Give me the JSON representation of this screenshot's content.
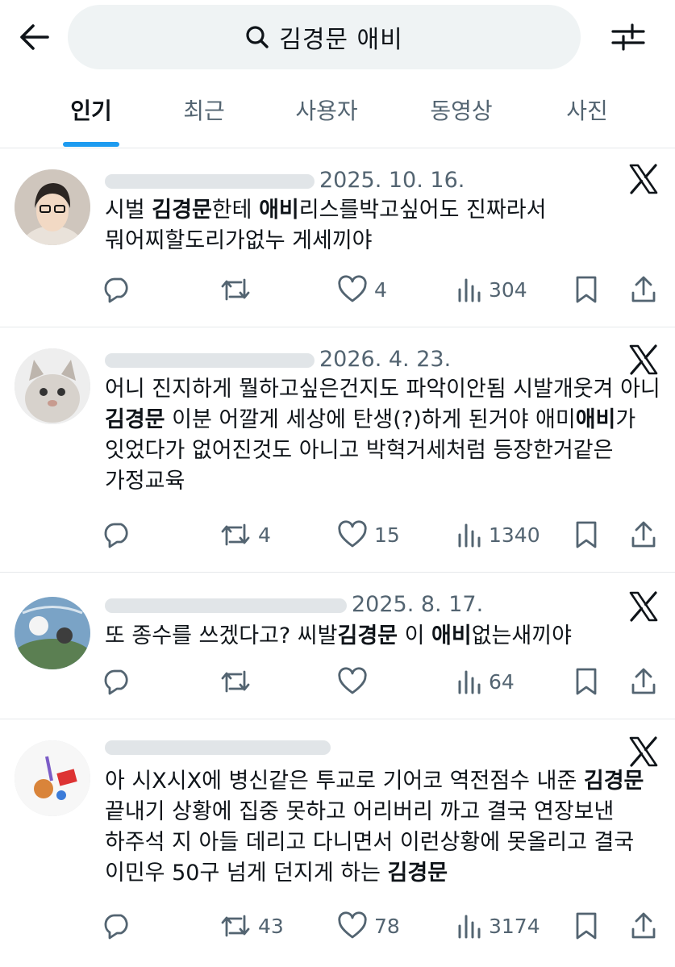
{
  "search": {
    "query": "김경문 애비"
  },
  "tabs": [
    {
      "label": "인기"
    },
    {
      "label": "최근"
    },
    {
      "label": "사용자"
    },
    {
      "label": "동영상"
    },
    {
      "label": "사진"
    }
  ],
  "active_tab": "인기",
  "posts": [
    {
      "date": "2025. 10. 16.",
      "text_parts": [
        "시벌 ",
        "김경문",
        "한테 ",
        "애비",
        "리스를박고싶어도 진짜라서 뭐어찌할도리가없누  게세끼야"
      ],
      "replies": "",
      "reposts": "",
      "likes": "4",
      "views": "304"
    },
    {
      "date": "2026. 4. 23.",
      "text_parts": [
        "어니 진지하게 뭘하고싶은건지도  파악이안됨 시발개웃겨 아니  ",
        "김경문",
        " 이분 어깔게  세상에 탄생(?)하게 된거야  애미",
        "애비",
        "가 잇었다가 없어진것도 아니고  박혁거세처럼 등장한거같은  가정교육"
      ],
      "replies": "",
      "reposts": "4",
      "likes": "15",
      "views": "1340"
    },
    {
      "date": "2025. 8. 17.",
      "text_parts": [
        "또 종수를 쓰겠다고? 씨발",
        "김경문",
        " 이 ",
        "애비",
        "없는새끼야"
      ],
      "replies": "",
      "reposts": "",
      "likes": "",
      "views": "64"
    },
    {
      "date": "",
      "text_parts": [
        "아 시X시X에 병신같은 투교로 기어코 역전점수 내준 ",
        "김경문",
        " 끝내기 상황에 집중 못하고 어리버리 까고 결국 연장보낸 하주석 지 아들 데리고 다니면서 이런상황에 못올리고 결국 이민우 50구 넘게 던지게 하는 ",
        "김경문",
        ""
      ],
      "replies": "",
      "reposts": "43",
      "likes": "78",
      "views": "3174"
    }
  ],
  "colors": {
    "accent": "#1d9bf0",
    "muted": "#536471",
    "text": "#0f1419",
    "divider": "#e6e9eb",
    "pill": "#eff3f4"
  },
  "icons": [
    "back-arrow-icon",
    "search-icon",
    "filter-icon",
    "x-logo-icon",
    "reply-icon",
    "repost-icon",
    "like-icon",
    "views-icon",
    "bookmark-icon",
    "share-icon"
  ]
}
